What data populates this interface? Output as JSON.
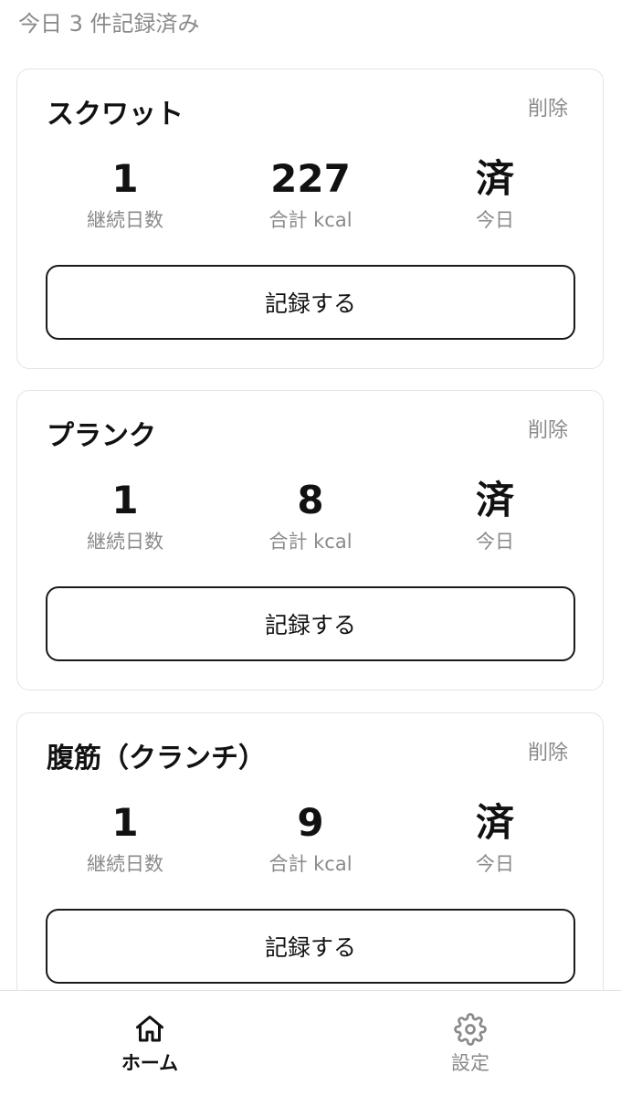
{
  "summary": "今日 3 件記録済み",
  "cards": [
    {
      "title": "スクワット",
      "delete_label": "削除",
      "streak_value": "1",
      "streak_label": "継続日数",
      "kcal_value": "227",
      "kcal_label": "合計 kcal",
      "today_value": "済",
      "today_label": "今日",
      "record_label": "記録する"
    },
    {
      "title": "プランク",
      "delete_label": "削除",
      "streak_value": "1",
      "streak_label": "継続日数",
      "kcal_value": "8",
      "kcal_label": "合計 kcal",
      "today_value": "済",
      "today_label": "今日",
      "record_label": "記録する"
    },
    {
      "title": "腹筋（クランチ）",
      "delete_label": "削除",
      "streak_value": "1",
      "streak_label": "継続日数",
      "kcal_value": "9",
      "kcal_label": "合計 kcal",
      "today_value": "済",
      "today_label": "今日",
      "record_label": "記録する"
    }
  ],
  "tabbar": {
    "home": {
      "label": "ホーム",
      "icon": "home-icon",
      "active": true
    },
    "settings": {
      "label": "設定",
      "icon": "gear-icon",
      "active": false
    }
  },
  "colors": {
    "text": "#111111",
    "muted": "#8a8a8a",
    "border": "#e4e4e4",
    "button_border": "#1a1a1a"
  }
}
